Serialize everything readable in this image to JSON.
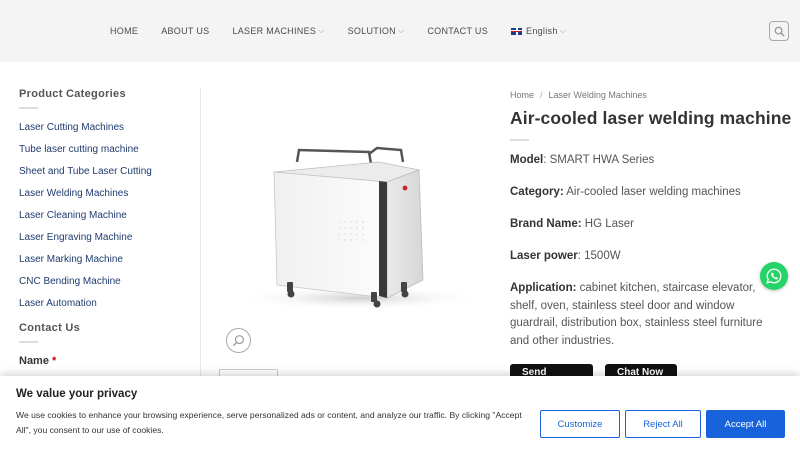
{
  "header": {
    "nav": [
      {
        "label": "HOME",
        "has_dropdown": false
      },
      {
        "label": "ABOUT US",
        "has_dropdown": false
      },
      {
        "label": "LASER MACHINES",
        "has_dropdown": true
      },
      {
        "label": "SOLUTION",
        "has_dropdown": true
      },
      {
        "label": "CONTACT US",
        "has_dropdown": false
      }
    ],
    "language": "English",
    "search_icon": "search-icon"
  },
  "sidebar": {
    "categories_title": "Product Categories",
    "categories": [
      "Laser Cutting Machines",
      "Tube laser cutting machine",
      "Sheet and Tube Laser Cutting",
      "Laser Welding Machines",
      "Laser Cleaning Machine",
      "Laser Engraving Machine",
      "Laser Marking Machine",
      "CNC Bending Machine",
      "Laser Automation"
    ],
    "contact_title": "Contact Us",
    "name_label": "Name",
    "required_mark": "*"
  },
  "product": {
    "breadcrumb": [
      "Home",
      "Laser Welding Machines"
    ],
    "breadcrumb_sep": "/",
    "title": "Air-cooled laser welding machine",
    "specs": {
      "model_label": "Model",
      "model_value": ": SMART HWA Series",
      "category_label": "Category:",
      "category_value": " Air-cooled laser welding machines",
      "brand_label": "Brand Name:",
      "brand_value": " HG Laser",
      "power_label": "Laser power",
      "power_value": ": 1500W",
      "application_label": "Application:",
      "application_value": " cabinet kitchen, staircase elevator, shelf, oven, stainless steel door and window guardrail, distribution box, stainless steel furniture and other industries."
    },
    "buttons": {
      "inquiry": "Send Inquiry",
      "chat": "Chat Now"
    }
  },
  "cookie": {
    "title": "We value your privacy",
    "text": "We use cookies to enhance your browsing experience, serve personalized ads or content, and analyze our traffic. By clicking \"Accept All\", you consent to our use of cookies.",
    "customize": "Customize",
    "reject": "Reject All",
    "accept": "Accept All"
  },
  "colors": {
    "accent": "#1863dc",
    "whatsapp": "#25d366",
    "nav_bg": "#f4f4f4"
  }
}
